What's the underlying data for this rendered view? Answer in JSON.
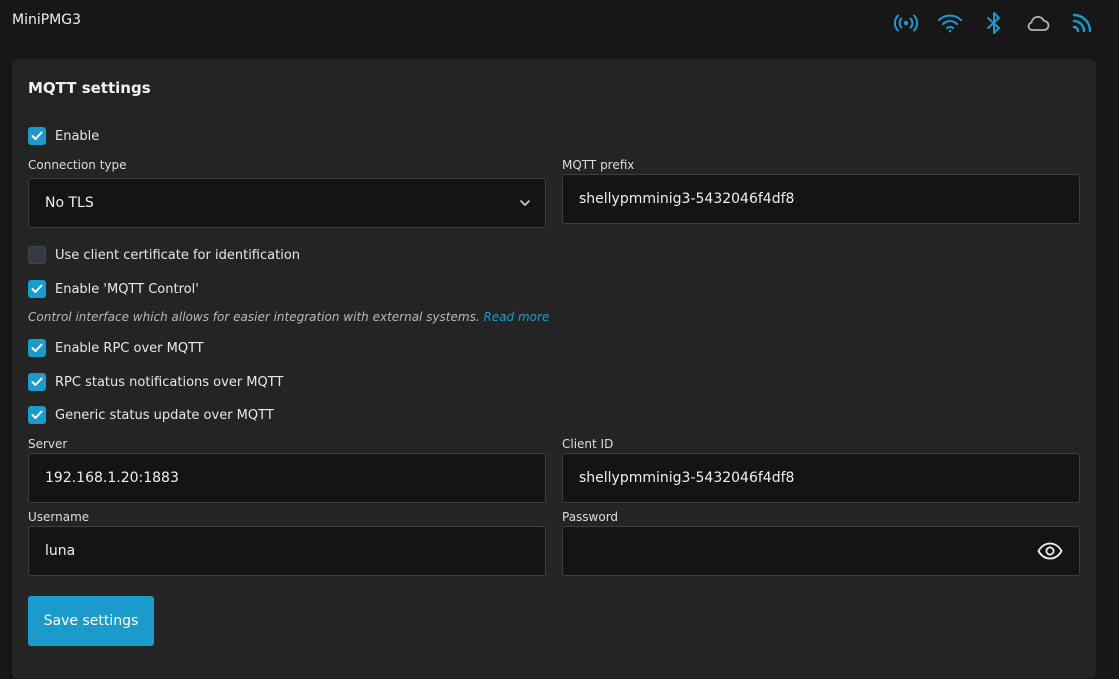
{
  "header": {
    "title": "MiniPMG3",
    "icons": [
      "broadcast-icon",
      "wifi-icon",
      "bluetooth-icon",
      "cloud-icon",
      "rss-icon"
    ],
    "accent_color": "#1b9bcb"
  },
  "mqtt": {
    "title": "MQTT settings",
    "enable": {
      "label": "Enable",
      "checked": true
    },
    "connection_type": {
      "label": "Connection type",
      "value": "No TLS"
    },
    "mqtt_prefix": {
      "label": "MQTT prefix",
      "value": "shellypmminig3-5432046f4df8"
    },
    "client_cert": {
      "label": "Use client certificate for identification",
      "checked": false
    },
    "mqtt_control": {
      "label": "Enable 'MQTT Control'",
      "checked": true
    },
    "help": {
      "text": "Control interface which allows for easier integration with external systems.",
      "link": "Read more"
    },
    "rpc": {
      "label": "Enable RPC over MQTT",
      "checked": true
    },
    "rpc_status": {
      "label": "RPC status notifications over MQTT",
      "checked": true
    },
    "generic_status": {
      "label": "Generic status update over MQTT",
      "checked": true
    },
    "server": {
      "label": "Server",
      "value": "192.168.1.20:1883"
    },
    "client_id": {
      "label": "Client ID",
      "value": "shellypmminig3-5432046f4df8"
    },
    "username": {
      "label": "Username",
      "value": "luna"
    },
    "password": {
      "label": "Password",
      "value": ""
    },
    "save_label": "Save settings"
  }
}
